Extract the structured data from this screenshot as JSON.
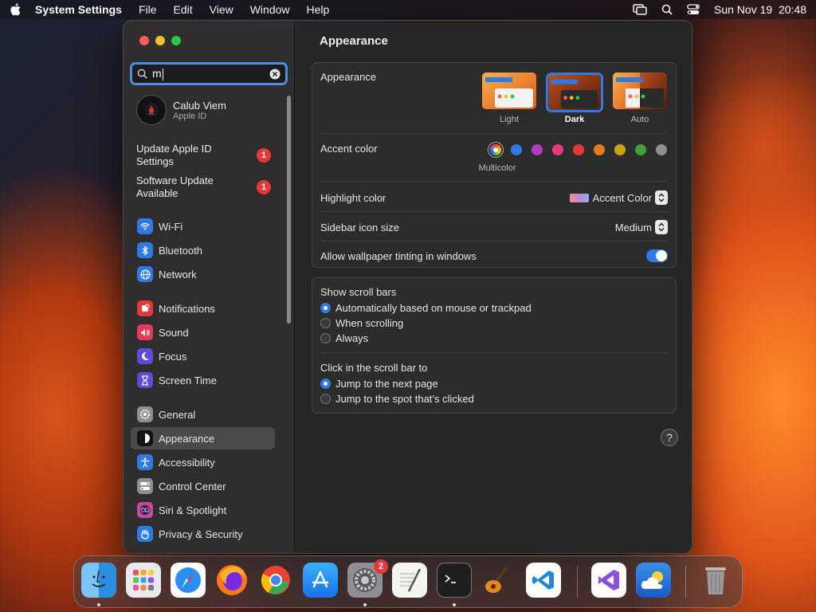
{
  "menubar": {
    "app": "System Settings",
    "items": [
      "File",
      "Edit",
      "View",
      "Window",
      "Help"
    ],
    "date": "Sun Nov 19",
    "time": "20:48"
  },
  "search": {
    "query": "m"
  },
  "account": {
    "name": "Calub Viem",
    "sub": "Apple ID"
  },
  "notices": [
    {
      "label": "Update Apple ID Settings",
      "badge": "1"
    },
    {
      "label": "Software Update Available",
      "badge": "1"
    }
  ],
  "sidebar": {
    "items": [
      {
        "label": "Wi-Fi",
        "icon": "wifi-icon",
        "color": "#2f7ae5"
      },
      {
        "label": "Bluetooth",
        "icon": "bluetooth-icon",
        "color": "#2f7ae5"
      },
      {
        "label": "Network",
        "icon": "globe-icon",
        "color": "#2f7ae5"
      },
      {
        "label": "Notifications",
        "icon": "bell-icon",
        "color": "#e5383b"
      },
      {
        "label": "Sound",
        "icon": "speaker-icon",
        "color": "#e5385a"
      },
      {
        "label": "Focus",
        "icon": "moon-icon",
        "color": "#5e4bd6"
      },
      {
        "label": "Screen Time",
        "icon": "hourglass-icon",
        "color": "#5e4bd6"
      },
      {
        "label": "General",
        "icon": "gear-icon",
        "color": "#8e8e93"
      },
      {
        "label": "Appearance",
        "icon": "appearance-icon",
        "color": "#111111"
      },
      {
        "label": "Accessibility",
        "icon": "accessibility-icon",
        "color": "#2f7ae5"
      },
      {
        "label": "Control Center",
        "icon": "switches-icon",
        "color": "#8e8e93"
      },
      {
        "label": "Siri & Spotlight",
        "icon": "siri-icon",
        "color": "#c04aa0"
      },
      {
        "label": "Privacy & Security",
        "icon": "hand-icon",
        "color": "#2f7ae5"
      }
    ],
    "selected": "Appearance"
  },
  "main": {
    "title": "Appearance",
    "appearance": {
      "label": "Appearance",
      "options": [
        "Light",
        "Dark",
        "Auto"
      ],
      "selected": "Dark"
    },
    "accent": {
      "label": "Accent color",
      "selected_label": "Multicolor",
      "colors": [
        "multicolor",
        "#2f7ae5",
        "#b03fc0",
        "#e23a7c",
        "#e5383b",
        "#e27d17",
        "#c9a213",
        "#3fa13a",
        "#8e8e93"
      ]
    },
    "highlight": {
      "label": "Highlight color",
      "value": "Accent Color"
    },
    "sidebar_icon": {
      "label": "Sidebar icon size",
      "value": "Medium"
    },
    "tinting": {
      "label": "Allow wallpaper tinting in windows",
      "on": true
    },
    "scrollbars": {
      "label": "Show scroll bars",
      "options": [
        "Automatically based on mouse or trackpad",
        "When scrolling",
        "Always"
      ],
      "selected": 0
    },
    "click": {
      "label": "Click in the scroll bar to",
      "options": [
        "Jump to the next page",
        "Jump to the spot that’s clicked"
      ],
      "selected": 0
    },
    "help": "?"
  },
  "dock": {
    "badge_settings": "2",
    "apps": [
      "finder-icon",
      "launchpad-icon",
      "safari-icon",
      "firefox-icon",
      "chrome-icon",
      "app-store-icon",
      "system-settings-icon",
      "textedit-icon",
      "terminal-icon",
      "garageband-icon",
      "vscode-icon",
      "visual-studio-icon",
      "weather-icon",
      "trash-icon"
    ]
  }
}
